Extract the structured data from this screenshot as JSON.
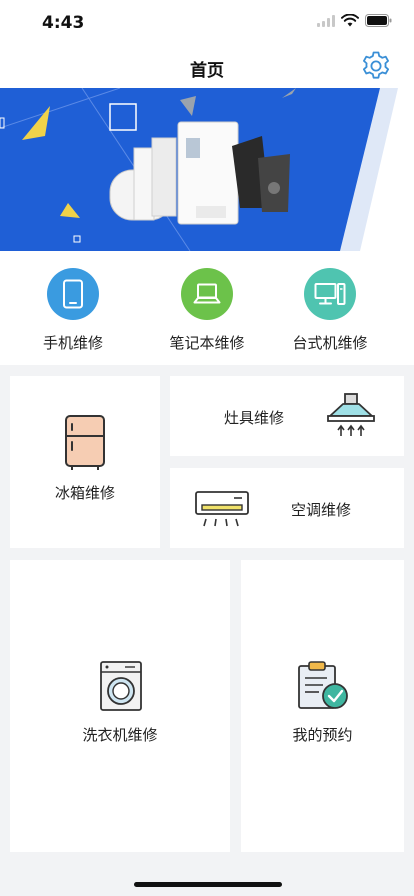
{
  "status_bar": {
    "time": "4:43"
  },
  "nav": {
    "title": "首页"
  },
  "categories": [
    {
      "label": "手机维修",
      "color": "#3a9be0"
    },
    {
      "label": "笔记本维修",
      "color": "#6cc24a"
    },
    {
      "label": "台式机维修",
      "color": "#4fc4b0"
    }
  ],
  "services": {
    "fridge": "冰箱维修",
    "stove": "灶具维修",
    "ac": "空调维修",
    "washer": "洗衣机维修",
    "booking": "我的预约"
  },
  "colors": {
    "banner_blue": "#1f5fd6",
    "background": "#f2f3f5"
  }
}
